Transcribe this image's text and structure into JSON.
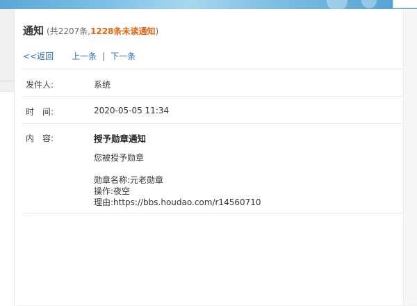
{
  "notice": {
    "title": "通知",
    "meta_open": "(共2207条,",
    "unread_text": "1228条未读通知",
    "meta_close": ")"
  },
  "nav": {
    "back": "<<返回",
    "prev": "上一条",
    "divider": "|",
    "next": "下一条"
  },
  "fields": {
    "sender_label": "发件人:",
    "sender_value": "系统",
    "time_label": "时　间:",
    "time_value": "2020-05-05 11:34",
    "content_label": "内　容:"
  },
  "content": {
    "title": "授予勋章通知",
    "line1": "您被授予勋章",
    "line2": "勋章名称:元老勋章",
    "line3": "操作:夜空",
    "line4": "理由:https://bbs.houdao.com/r14560710"
  },
  "colors": {
    "unread": "#e8620c",
    "link": "#2b6fb5"
  }
}
